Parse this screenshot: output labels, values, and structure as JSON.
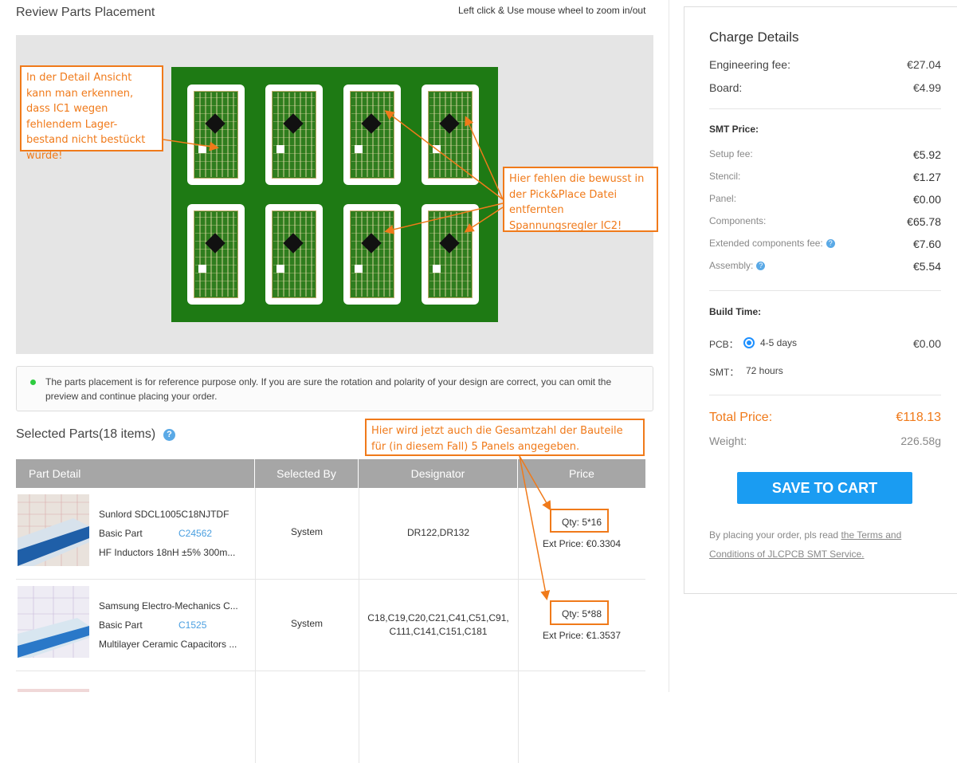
{
  "header": {
    "title": "Review Parts Placement",
    "zoom_hint": "Left click & Use mouse wheel to zoom in/out"
  },
  "notice": {
    "text": "The parts placement is for reference purpose only. If you are sure the rotation and polarity of your design are correct, you can omit the preview and continue placing your order."
  },
  "selected_parts": {
    "title": "Selected Parts(18 items)"
  },
  "table": {
    "headers": [
      "Part Detail",
      "Selected By",
      "Designator",
      "Price"
    ],
    "rows": [
      {
        "name": "Sunlord SDCL1005C18NJTDF",
        "type": "Basic Part",
        "code": "C24562",
        "desc": "HF Inductors 18nH ±5% 300m...",
        "selected_by": "System",
        "designator": "DR122,DR132",
        "qty": "Qty: 5*16",
        "ext_price": "Ext Price: €0.3304"
      },
      {
        "name": "Samsung Electro-Mechanics C...",
        "type": "Basic Part",
        "code": "C1525",
        "desc": "Multilayer Ceramic Capacitors ...",
        "selected_by": "System",
        "designator": "C18,C19,C20,C21,C41,C51,C91,\nC111,C141,C151,C181",
        "qty": "Qty: 5*88",
        "ext_price": "Ext Price: €1.3537"
      }
    ]
  },
  "annotations": {
    "ic1": "In der Detail Ansicht kann man erkennen, dass IC1 wegen fehlendem Lager-bestand nicht bestückt würde!",
    "ic2": "Hier fehlen die bewusst in der Pick&Place Datei entfernten Spannungsregler IC2!",
    "total": "Hier wird jetzt auch die Gesamtzahl der Bauteile für (in diesem Fall) 5 Panels angegeben."
  },
  "charge": {
    "title": "Charge Details",
    "engineering_label": "Engineering fee:",
    "engineering_value": "€27.04",
    "board_label": "Board:",
    "board_value": "€4.99",
    "smt_title": "SMT Price:",
    "smt_items": [
      {
        "label": "Setup fee:",
        "value": "€5.92"
      },
      {
        "label": "Stencil:",
        "value": "€1.27"
      },
      {
        "label": "Panel:",
        "value": "€0.00"
      },
      {
        "label": "Components:",
        "value": "€65.78"
      },
      {
        "label": "Extended components fee:",
        "value": "€7.60"
      },
      {
        "label": "Assembly:",
        "value": "€5.54"
      }
    ],
    "build_title": "Build Time:",
    "pcb_label": "PCB：",
    "pcb_option": "4-5 days",
    "pcb_value": "€0.00",
    "smt_label": "SMT：",
    "smt_value": "72 hours",
    "total_label": "Total Price:",
    "total_value": "€118.13",
    "weight_label": "Weight:",
    "weight_value": "226.58g",
    "save_button": "SAVE TO CART",
    "terms_prefix": "By placing your order, pls read",
    "terms_link": "the Terms and Conditions of JLCPCB SMT Service."
  },
  "colors": {
    "accent": "#1a9cf2",
    "annotation": "#f07a1a",
    "total": "#f07a1a",
    "board": "#1e7a14"
  }
}
